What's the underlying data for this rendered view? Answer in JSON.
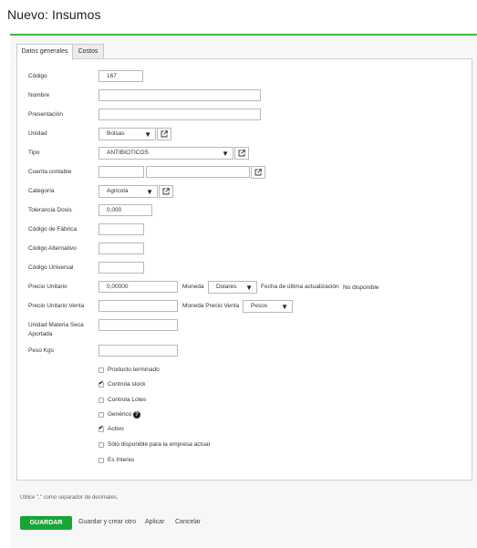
{
  "page": {
    "title": "Nuevo: Insumos"
  },
  "tabs": [
    {
      "label": "Datos generales"
    },
    {
      "label": "Costos"
    }
  ],
  "form": {
    "codigo": {
      "label": "Código",
      "value": "167"
    },
    "nombre": {
      "label": "Nombre",
      "value": ""
    },
    "presentacion": {
      "label": "Presentación",
      "value": ""
    },
    "unidad": {
      "label": "Unidad",
      "value": "Bolsas"
    },
    "tipo": {
      "label": "Tipo",
      "value": "ANTIBIOTICOS"
    },
    "cuenta_contable": {
      "label": "Cuenta contable",
      "value1": "",
      "value2": ""
    },
    "categoria": {
      "label": "Categoría",
      "value": "Agricola"
    },
    "tolerancia_dosis": {
      "label": "Tolerancia Dosis",
      "value": "0,000"
    },
    "codigo_fabrica": {
      "label": "Código de Fábrica",
      "value": ""
    },
    "codigo_alternativo": {
      "label": "Código Alternativo",
      "value": ""
    },
    "codigo_universal": {
      "label": "Código Universal",
      "value": ""
    },
    "precio_unitario": {
      "label": "Precio Unitario",
      "value": "0,00000"
    },
    "moneda": {
      "label": "Moneda",
      "value": "Dolares"
    },
    "fecha_actualizacion": {
      "label": "Fecha de última actualización",
      "value": "No disponible"
    },
    "precio_unitario_venta": {
      "label": "Precio Unitario Venta",
      "value": ""
    },
    "moneda_precio_venta": {
      "label": "Moneda Precio Venta",
      "value": "Pesos"
    },
    "unidad_materia_seca": {
      "label_line1": "Unidad Materia Seca",
      "label_line2": "Aportada",
      "value": ""
    },
    "peso_kgs": {
      "label": "Peso Kgs",
      "value": ""
    }
  },
  "checkboxes": [
    {
      "label": "Producto terminado",
      "checked": false
    },
    {
      "label": "Controla stock",
      "checked": true
    },
    {
      "label": "Controla Lotes",
      "checked": false
    },
    {
      "label": "Genérico",
      "checked": false
    },
    {
      "label": "Activo",
      "checked": true
    },
    {
      "label": "Sólo disponible para la empresa actual",
      "checked": false
    },
    {
      "label": "Es Interes",
      "checked": false
    }
  ],
  "icons": {
    "dropdown": "▼",
    "help": "?",
    "check": "✔",
    "external_link": "external-link-icon"
  },
  "colors": {
    "accent_green": "#3dbb35",
    "save_button": "#19a535"
  },
  "footer": {
    "note": "Utilice \",\" como separador de decimales.",
    "save_label": "GUARDAR",
    "save_create_label": "Guardar y crear otro",
    "apply_label": "Aplicar",
    "cancel_label": "Cancelar"
  }
}
